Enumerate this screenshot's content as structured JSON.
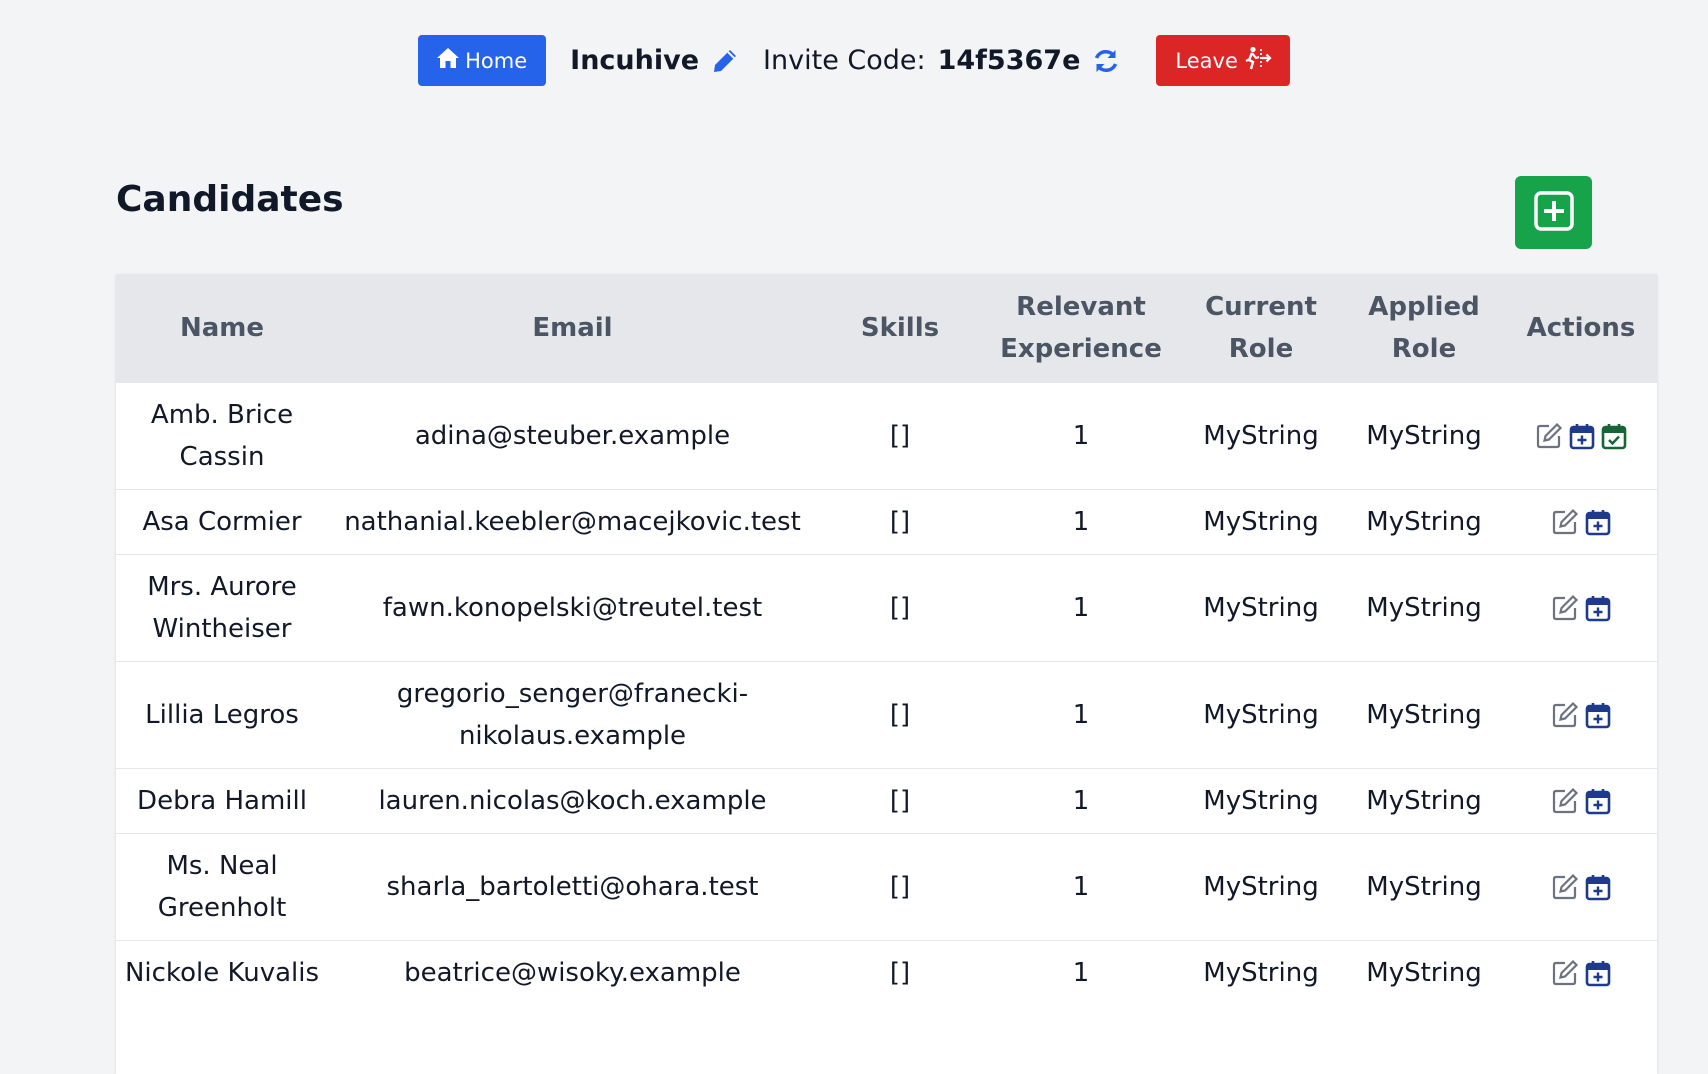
{
  "header": {
    "home_label": "Home",
    "team_name": "Incuhive",
    "invite_label": "Invite Code:",
    "invite_code": "14f5367e",
    "leave_label": "Leave"
  },
  "page": {
    "title": "Candidates"
  },
  "table": {
    "columns": {
      "name": "Name",
      "email": "Email",
      "skills": "Skills",
      "experience": "Relevant Experience",
      "current_role": "Current Role",
      "applied_role": "Applied Role",
      "actions": "Actions"
    },
    "rows": [
      {
        "name": "Amb. Brice Cassin",
        "email": "adina@steuber.example",
        "skills": "[]",
        "experience": "1",
        "current_role": "MyString",
        "applied_role": "MyString",
        "scheduled": true
      },
      {
        "name": "Asa Cormier",
        "email": "nathanial.keebler@macejkovic.test",
        "skills": "[]",
        "experience": "1",
        "current_role": "MyString",
        "applied_role": "MyString",
        "scheduled": false
      },
      {
        "name": "Mrs. Aurore Wintheiser",
        "email": "fawn.konopelski@treutel.test",
        "skills": "[]",
        "experience": "1",
        "current_role": "MyString",
        "applied_role": "MyString",
        "scheduled": false
      },
      {
        "name": "Lillia Legros",
        "email": "gregorio_senger@franecki-nikolaus.example",
        "skills": "[]",
        "experience": "1",
        "current_role": "MyString",
        "applied_role": "MyString",
        "scheduled": false
      },
      {
        "name": "Debra Hamill",
        "email": "lauren.nicolas@koch.example",
        "skills": "[]",
        "experience": "1",
        "current_role": "MyString",
        "applied_role": "MyString",
        "scheduled": false
      },
      {
        "name": "Ms. Neal Greenholt",
        "email": "sharla_bartoletti@ohara.test",
        "skills": "[]",
        "experience": "1",
        "current_role": "MyString",
        "applied_role": "MyString",
        "scheduled": false
      },
      {
        "name": "Nickole Kuvalis",
        "email": "beatrice@wisoky.example",
        "skills": "[]",
        "experience": "1",
        "current_role": "MyString",
        "applied_role": "MyString",
        "scheduled": false
      }
    ]
  },
  "icons": {
    "home": "home-icon",
    "edit_team": "pencil-icon",
    "refresh": "refresh-icon",
    "leave": "exit-icon",
    "add": "plus-square-icon",
    "row_edit": "edit-icon",
    "row_schedule": "calendar-plus-icon",
    "row_scheduled": "calendar-check-icon"
  },
  "colors": {
    "primary": "#2563eb",
    "danger": "#dc2626",
    "success": "#16a34a",
    "header_bg": "#e5e7eb",
    "calendar_blue": "#1e3a8a",
    "calendar_green": "#166534"
  }
}
